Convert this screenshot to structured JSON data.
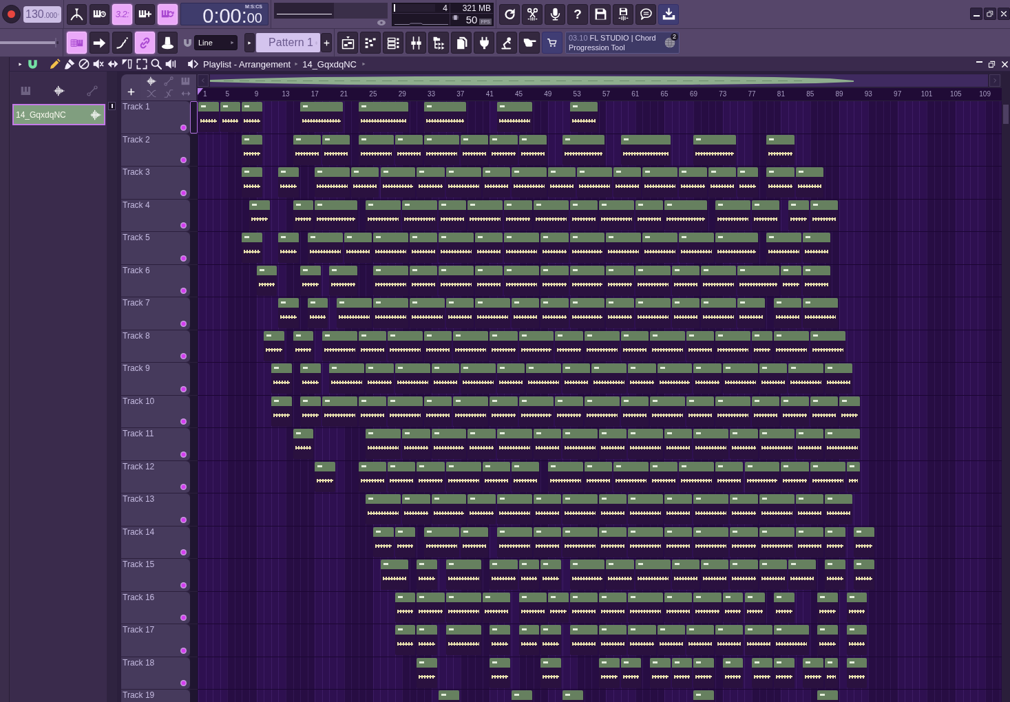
{
  "top_bar": {
    "tempo": {
      "value": "130",
      "fraction": ".000"
    },
    "modes": [
      {
        "kind": "metronome",
        "on": false
      },
      {
        "kind": "wait_input",
        "on": false
      },
      {
        "kind": "countdown",
        "label": "3.2:",
        "on": true
      },
      {
        "kind": "step_edit",
        "on": false
      },
      {
        "kind": "loop_record",
        "on": true
      }
    ],
    "time": {
      "value": "0:00:",
      "centis": "00",
      "format": "M:S:CS"
    },
    "monitor": {
      "cpu": {
        "level": 0.03
      },
      "polyphony": "4",
      "memory": "321 MB",
      "fps": "50",
      "fps_label": "FPS"
    },
    "actions": [
      {
        "kind": "undo",
        "highlight": false
      },
      {
        "kind": "cut",
        "highlight": false
      },
      {
        "kind": "mic",
        "highlight": false
      },
      {
        "kind": "help",
        "label": "?",
        "highlight": false
      },
      {
        "kind": "save",
        "highlight": false
      },
      {
        "kind": "save_audio",
        "highlight": false
      },
      {
        "kind": "chat",
        "highlight": false
      },
      {
        "kind": "download",
        "highlight": true
      }
    ],
    "window_controls": [
      {
        "kind": "minimize"
      },
      {
        "kind": "restore"
      },
      {
        "kind": "close"
      }
    ]
  },
  "second_bar": {
    "master_slider": {
      "level": 0.97
    },
    "tools": [
      {
        "kind": "piano_playlist",
        "on": true
      },
      {
        "kind": "arrow",
        "on": false
      },
      {
        "kind": "curve",
        "on": false
      },
      {
        "kind": "link",
        "on": true
      },
      {
        "kind": "knob",
        "on": false
      }
    ],
    "snap": {
      "value": "Line"
    },
    "pattern": {
      "value": "Pattern 1"
    },
    "windows": [
      {
        "kind": "playlist",
        "highlight": false
      },
      {
        "kind": "channel_rack",
        "highlight": false
      },
      {
        "kind": "list",
        "highlight": false
      },
      {
        "kind": "mixer",
        "highlight": false
      },
      {
        "kind": "browser",
        "highlight": false
      },
      {
        "kind": "pages",
        "highlight": false
      },
      {
        "kind": "plugin",
        "highlight": false
      },
      {
        "kind": "lamp",
        "highlight": false
      },
      {
        "kind": "hand",
        "highlight": false
      },
      {
        "kind": "shop",
        "highlight": true
      }
    ],
    "news": {
      "date": "03.10",
      "title": "FL STUDIO | Chord Progression Tool",
      "badge": "2"
    }
  },
  "playlist": {
    "snap": {
      "on": true
    },
    "tools": [
      {
        "kind": "draw",
        "selected": true
      },
      {
        "kind": "paint",
        "selected": false
      },
      {
        "kind": "delete",
        "selected": false
      },
      {
        "kind": "mute",
        "selected": false
      },
      {
        "kind": "slip",
        "selected": false
      },
      {
        "kind": "select",
        "selected": false
      },
      {
        "kind": "zoom",
        "selected": false
      },
      {
        "kind": "magnify",
        "selected": false
      },
      {
        "kind": "playback",
        "selected": false
      }
    ],
    "title": "Playlist - Arrangement",
    "path": "14_GqxdqNC",
    "window_controls": [
      {
        "kind": "minimize"
      },
      {
        "kind": "restore"
      },
      {
        "kind": "close"
      }
    ],
    "picker": {
      "tabs": [
        {
          "kind": "patterns",
          "selected": false
        },
        {
          "kind": "audio",
          "selected": true
        },
        {
          "kind": "automation",
          "selected": false
        }
      ],
      "items": [
        {
          "name": "14_GqxdqNC",
          "selected": true
        }
      ]
    },
    "track_tools": [
      {
        "kind": "audio",
        "on": true
      },
      {
        "kind": "automation",
        "on": false
      },
      {
        "kind": "patterns",
        "on": false
      },
      {
        "kind": "crossfade",
        "on": false
      },
      {
        "kind": "slope",
        "on": false
      },
      {
        "kind": "stretch",
        "on": false
      }
    ],
    "ruler": [
      "1",
      "5",
      "9",
      "13",
      "17",
      "21",
      "25",
      "29",
      "33",
      "37",
      "41",
      "45",
      "49",
      "53",
      "57",
      "61",
      "65",
      "69",
      "73",
      "77",
      "81",
      "85",
      "89",
      "93",
      "97",
      "101",
      "105",
      "109"
    ],
    "tracks": [
      {
        "name": "Track 1",
        "selected": true,
        "enabled": true
      },
      {
        "name": "Track 2",
        "selected": false,
        "enabled": true
      },
      {
        "name": "Track 3",
        "selected": false,
        "enabled": true
      },
      {
        "name": "Track 4",
        "selected": false,
        "enabled": true
      },
      {
        "name": "Track 5",
        "selected": false,
        "enabled": true
      },
      {
        "name": "Track 6",
        "selected": false,
        "enabled": true
      },
      {
        "name": "Track 7",
        "selected": false,
        "enabled": true
      },
      {
        "name": "Track 8",
        "selected": false,
        "enabled": true
      },
      {
        "name": "Track 9",
        "selected": false,
        "enabled": true
      },
      {
        "name": "Track 10",
        "selected": false,
        "enabled": true
      },
      {
        "name": "Track 11",
        "selected": false,
        "enabled": true
      },
      {
        "name": "Track 12",
        "selected": false,
        "enabled": true
      },
      {
        "name": "Track 13",
        "selected": false,
        "enabled": true
      },
      {
        "name": "Track 14",
        "selected": false,
        "enabled": true
      },
      {
        "name": "Track 15",
        "selected": false,
        "enabled": true
      },
      {
        "name": "Track 16",
        "selected": false,
        "enabled": true
      },
      {
        "name": "Track 17",
        "selected": false,
        "enabled": true
      },
      {
        "name": "Track 18",
        "selected": false,
        "enabled": true
      },
      {
        "name": "Track 19",
        "selected": false
      }
    ]
  }
}
